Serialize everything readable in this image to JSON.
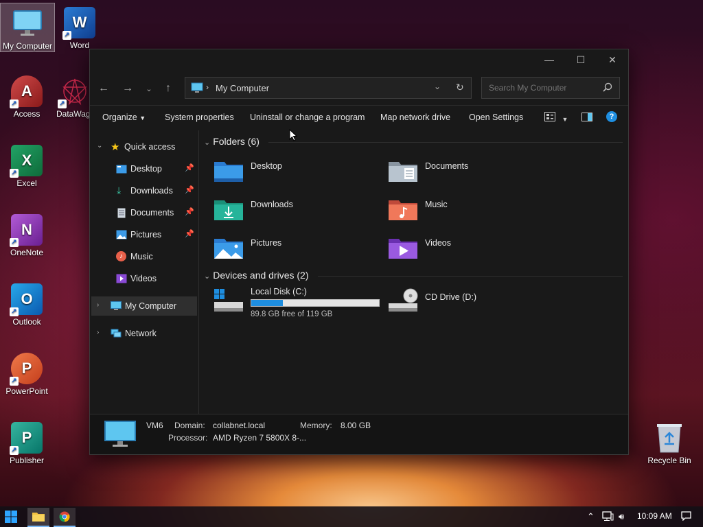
{
  "desktop": {
    "icons": [
      {
        "label": "My Computer"
      },
      {
        "label": "Word"
      },
      {
        "label": "Access"
      },
      {
        "label": "DataWag"
      },
      {
        "label": "Excel"
      },
      {
        "label": "OneNote"
      },
      {
        "label": "Outlook"
      },
      {
        "label": "PowerPoint"
      },
      {
        "label": "Publisher"
      },
      {
        "label": "Recycle Bin"
      }
    ]
  },
  "window": {
    "address": {
      "location": "My Computer"
    },
    "search": {
      "placeholder": "Search My Computer"
    },
    "toolbar": {
      "organize": "Organize",
      "system_properties": "System properties",
      "uninstall": "Uninstall or change a program",
      "map_drive": "Map network drive",
      "open_settings": "Open Settings"
    },
    "sidebar": {
      "quick_access": "Quick access",
      "items": [
        {
          "label": "Desktop",
          "icon": "desktop-icon",
          "pinned": true
        },
        {
          "label": "Downloads",
          "icon": "download-icon",
          "pinned": true
        },
        {
          "label": "Documents",
          "icon": "document-icon",
          "pinned": true
        },
        {
          "label": "Pictures",
          "icon": "picture-icon",
          "pinned": true
        },
        {
          "label": "Music",
          "icon": "music-icon",
          "pinned": false
        },
        {
          "label": "Videos",
          "icon": "video-icon",
          "pinned": false
        }
      ],
      "my_computer": "My Computer",
      "network": "Network"
    },
    "folders": {
      "header": "Folders (6)",
      "items": [
        {
          "label": "Desktop"
        },
        {
          "label": "Documents"
        },
        {
          "label": "Downloads"
        },
        {
          "label": "Music"
        },
        {
          "label": "Pictures"
        },
        {
          "label": "Videos"
        }
      ]
    },
    "drives": {
      "header": "Devices and drives (2)",
      "local": {
        "label": "Local Disk (C:)",
        "free_text": "89.8 GB free of 119 GB",
        "used_fraction": 0.245
      },
      "cd": {
        "label": "CD Drive (D:)"
      }
    },
    "details": {
      "name": "VM6",
      "domain_label": "Domain:",
      "domain_value": "collabnet.local",
      "memory_label": "Memory:",
      "memory_value": "8.00 GB",
      "processor_label": "Processor:",
      "processor_value": "AMD Ryzen 7 5800X 8-..."
    }
  },
  "taskbar": {
    "clock": "10:09 AM"
  },
  "colors": {
    "accent": "#1e8ee0",
    "window_bg": "#191919",
    "folder_blue": "#3b9be8",
    "folder_teal": "#26b49a",
    "quick_access_star": "#f5c518"
  }
}
